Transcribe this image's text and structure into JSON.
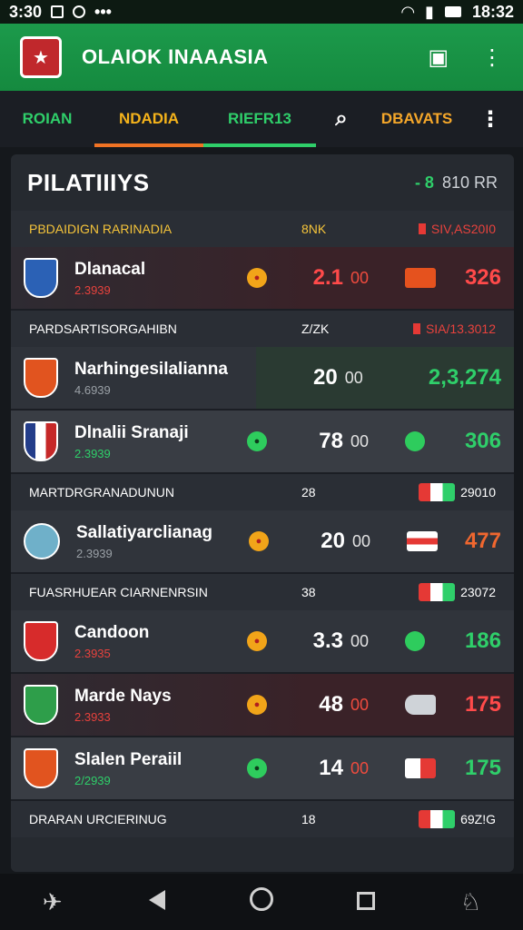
{
  "status_bar": {
    "time": "3:30",
    "clock": "18:32"
  },
  "app_bar": {
    "title": "OLAIOK INAAASIA"
  },
  "tabs": [
    "ROIAN",
    "NDADIA",
    "RIEFR13",
    "DBAVATS"
  ],
  "panel": {
    "title": "PILATIIIYS",
    "count_prefix": "- 8",
    "count": "810 RR"
  },
  "sections": [
    {
      "header": {
        "name": "PBDAIDIGN RARINADIA",
        "mid": "8NK",
        "right": "SIV,AS20I0"
      },
      "rows": [
        {
          "name": "Dlanacal",
          "sub": "2.3939",
          "score": "2.1",
          "timer": "00",
          "value": "326",
          "bg": "dark-red",
          "badge": "blue",
          "dot": "orange",
          "trend": "orange"
        }
      ]
    },
    {
      "header": {
        "name": "PARDSARTISORGAHIBN",
        "mid": "Z/ZK",
        "right": "SIA/13.3012"
      },
      "rows": [
        {
          "name": "Narhingesilalianna",
          "sub": "4.6939",
          "score": "20",
          "timer": "00",
          "value": "2,3,274",
          "bg": "green",
          "badge": "orange",
          "dot": "",
          "trend": ""
        },
        {
          "name": "Dlnalii Sranaji",
          "sub": "2.3939",
          "score": "78",
          "timer": "00",
          "value": "306",
          "bg": "grey",
          "badge": "navy",
          "dot": "green",
          "trend": "green-dot"
        }
      ]
    },
    {
      "header": {
        "name": "MARTDRGRANADUNUN",
        "mid": "28",
        "right": "29010"
      },
      "rows": [
        {
          "name": "Sallatiyarclianag",
          "sub": "2.3939",
          "score": "20",
          "timer": "00",
          "value": "477",
          "bg": "plain",
          "badge": "teal",
          "dot": "orange",
          "trend": "flag-ir"
        }
      ]
    },
    {
      "header": {
        "name": "FUASRHUEAR CIARNENRSIN",
        "mid": "38",
        "right": "23072"
      },
      "rows": [
        {
          "name": "Candoon",
          "sub": "2.3935",
          "score": "3.3",
          "timer": "00",
          "value": "186",
          "bg": "plain",
          "badge": "red",
          "dot": "orange",
          "trend": "green-dot"
        }
      ]
    },
    {
      "header": null,
      "rows": [
        {
          "name": "Marde Nays",
          "sub": "2.3933",
          "score": "48",
          "timer": "00",
          "value": "175",
          "bg": "dark-red",
          "badge": "green",
          "dot": "orange",
          "trend": "shoe"
        },
        {
          "name": "Slalen Peraiil",
          "sub": "2/2939",
          "score": "14",
          "timer": "00",
          "value": "175",
          "bg": "grey",
          "badge": "orange",
          "dot": "green",
          "trend": "half"
        }
      ]
    },
    {
      "header": {
        "name": "DRARAN URCIERINUG",
        "mid": "18",
        "right": "69Z!G"
      },
      "rows": []
    }
  ]
}
